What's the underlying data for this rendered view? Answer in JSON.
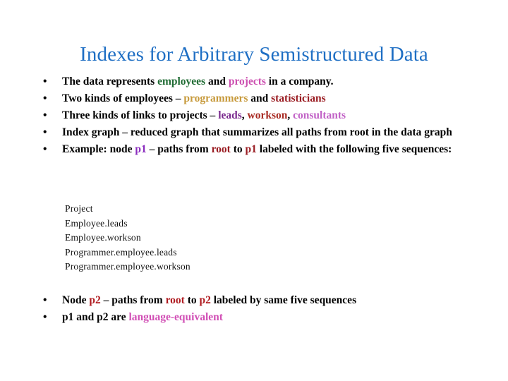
{
  "slide": {
    "title": "Indexes for Arbitrary Semistructured Data",
    "title_color": "#1F6FC4",
    "background_color": "#FFFFFF",
    "bullet_marker": "•"
  },
  "bullets_top": [
    {
      "id": "bullet-data-represents",
      "segments": [
        {
          "text": "The data represents ",
          "color": "#000000",
          "style": "plain"
        },
        {
          "text": "employees",
          "color": "#1F6B33",
          "style": "keyword"
        },
        {
          "text": " and ",
          "color": "#000000",
          "style": "plain"
        },
        {
          "text": "projects",
          "color": "#CC4FB0",
          "style": "keyword"
        },
        {
          "text": " in a company.",
          "color": "#000000",
          "style": "plain"
        }
      ]
    },
    {
      "id": "bullet-two-kinds-employees",
      "segments": [
        {
          "text": "Two kinds of employees – ",
          "color": "#000000",
          "style": "plain"
        },
        {
          "text": "programmers",
          "color": "#C79A3C",
          "style": "keyword"
        },
        {
          "text": " and ",
          "color": "#000000",
          "style": "plain"
        },
        {
          "text": "statisticians",
          "color": "#9A1C22",
          "style": "keyword"
        }
      ]
    },
    {
      "id": "bullet-three-kinds-links",
      "segments": [
        {
          "text": "Three kinds of links to projects – ",
          "color": "#000000",
          "style": "plain"
        },
        {
          "text": "leads",
          "color": "#7A2A8E",
          "style": "keyword"
        },
        {
          "text": ", ",
          "color": "#000000",
          "style": "plain"
        },
        {
          "text": "workson",
          "color": "#A82A22",
          "style": "keyword"
        },
        {
          "text": ", ",
          "color": "#000000",
          "style": "plain"
        },
        {
          "text": "consultants",
          "color": "#C161C6",
          "style": "keyword"
        }
      ]
    },
    {
      "id": "bullet-index-graph",
      "segments": [
        {
          "text": "Index graph – reduced graph that summarizes all paths from root in the data graph",
          "color": "#000000",
          "style": "plain"
        }
      ]
    },
    {
      "id": "bullet-example-p1",
      "segments": [
        {
          "text": "Example: node ",
          "color": "#000000",
          "style": "plain"
        },
        {
          "text": "p1",
          "color": "#8A2BBE",
          "style": "keyword"
        },
        {
          "text": " – paths from ",
          "color": "#000000",
          "style": "plain"
        },
        {
          "text": "root",
          "color": "#9A1C22",
          "style": "keyword"
        },
        {
          "text": " to ",
          "color": "#000000",
          "style": "plain"
        },
        {
          "text": "p1",
          "color": "#9A1C22",
          "style": "keyword"
        },
        {
          "text": " labeled with the following five sequences:",
          "color": "#000000",
          "style": "plain"
        }
      ]
    }
  ],
  "sequences": [
    "Project",
    "Employee.leads",
    "Employee.workson",
    "Programmer.employee.leads",
    "Programmer.employee.workson"
  ],
  "bullets_bottom": [
    {
      "id": "bullet-node-p2",
      "segments": [
        {
          "text": "Node ",
          "color": "#000000",
          "style": "plain"
        },
        {
          "text": "p2",
          "color": "#B01B20",
          "style": "keyword"
        },
        {
          "text": " – paths from ",
          "color": "#000000",
          "style": "plain"
        },
        {
          "text": "root",
          "color": "#B01B20",
          "style": "keyword"
        },
        {
          "text": " to ",
          "color": "#000000",
          "style": "plain"
        },
        {
          "text": "p2",
          "color": "#B01B20",
          "style": "keyword"
        },
        {
          "text": " labeled by same five sequences",
          "color": "#000000",
          "style": "plain"
        }
      ]
    },
    {
      "id": "bullet-language-equivalent",
      "segments": [
        {
          "text": "p1 and p2 are ",
          "color": "#000000",
          "style": "plain"
        },
        {
          "text": "language-equivalent",
          "color": "#D14FB5",
          "style": "keyword"
        }
      ]
    }
  ]
}
